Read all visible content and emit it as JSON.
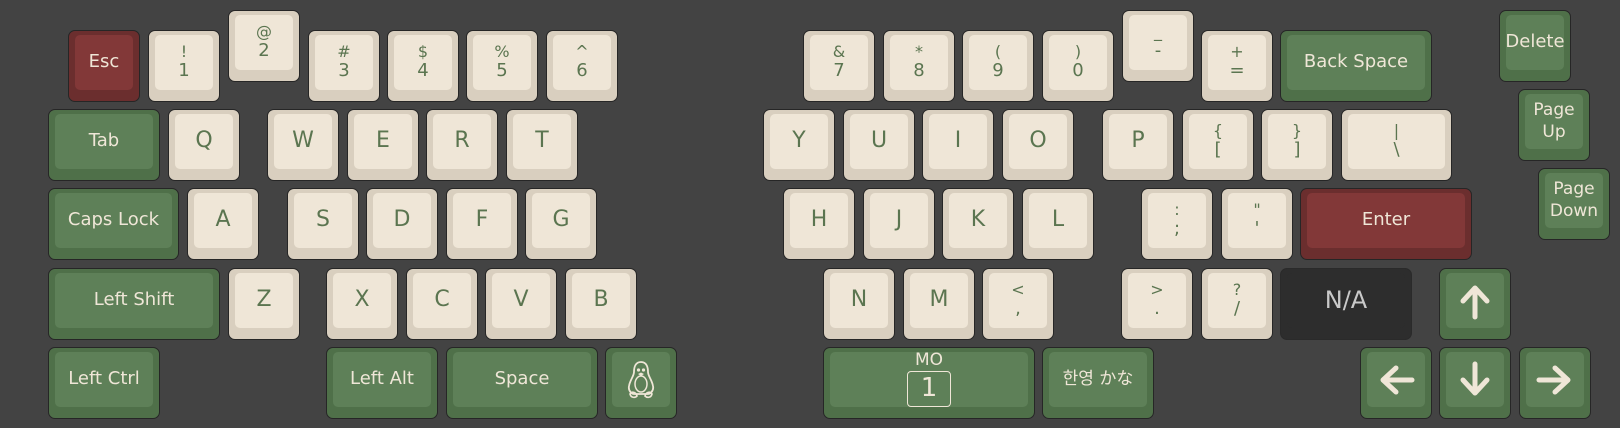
{
  "colors": {
    "background": "#434343",
    "alpha_cap": "#efe6d7",
    "alpha_text": "#5b7550",
    "mod_cap": "#5e8058",
    "accent_cap": "#823838",
    "na_cap": "#2d2d2d"
  },
  "keys": [
    {
      "id": "esc",
      "label": "Esc",
      "style": "acc",
      "text": "mod"
    },
    {
      "id": "1",
      "shift": "!",
      "base": "1",
      "style": "alpha"
    },
    {
      "id": "2",
      "shift": "@",
      "base": "2",
      "style": "alpha"
    },
    {
      "id": "3",
      "shift": "#",
      "base": "3",
      "style": "alpha"
    },
    {
      "id": "4",
      "shift": "$",
      "base": "4",
      "style": "alpha"
    },
    {
      "id": "5",
      "shift": "%",
      "base": "5",
      "style": "alpha"
    },
    {
      "id": "6",
      "shift": "^",
      "base": "6",
      "style": "alpha"
    },
    {
      "id": "7",
      "shift": "&",
      "base": "7",
      "style": "alpha"
    },
    {
      "id": "8",
      "shift": "*",
      "base": "8",
      "style": "alpha"
    },
    {
      "id": "9",
      "shift": "(",
      "base": "9",
      "style": "alpha"
    },
    {
      "id": "0",
      "shift": ")",
      "base": "0",
      "style": "alpha"
    },
    {
      "id": "minus",
      "shift": "_",
      "base": "-",
      "style": "alpha"
    },
    {
      "id": "equal",
      "shift": "+",
      "base": "=",
      "style": "alpha"
    },
    {
      "id": "backspace",
      "label": "Back Space",
      "style": "mod",
      "text": "mod"
    },
    {
      "id": "delete",
      "label": "Delete",
      "style": "mod",
      "text": "mod"
    },
    {
      "id": "tab",
      "label": "Tab",
      "style": "mod",
      "text": "mod"
    },
    {
      "id": "q",
      "label": "Q",
      "style": "alpha",
      "text": "main"
    },
    {
      "id": "w",
      "label": "W",
      "style": "alpha",
      "text": "main"
    },
    {
      "id": "e",
      "label": "E",
      "style": "alpha",
      "text": "main"
    },
    {
      "id": "r",
      "label": "R",
      "style": "alpha",
      "text": "main"
    },
    {
      "id": "t",
      "label": "T",
      "style": "alpha",
      "text": "main"
    },
    {
      "id": "y",
      "label": "Y",
      "style": "alpha",
      "text": "main"
    },
    {
      "id": "u",
      "label": "U",
      "style": "alpha",
      "text": "main"
    },
    {
      "id": "i",
      "label": "I",
      "style": "alpha",
      "text": "main"
    },
    {
      "id": "o",
      "label": "O",
      "style": "alpha",
      "text": "main"
    },
    {
      "id": "p",
      "label": "P",
      "style": "alpha",
      "text": "main"
    },
    {
      "id": "lbracket",
      "shift": "{",
      "base": "[",
      "style": "alpha"
    },
    {
      "id": "rbracket",
      "shift": "}",
      "base": "]",
      "style": "alpha"
    },
    {
      "id": "backslash",
      "shift": "|",
      "base": "\\",
      "style": "alpha"
    },
    {
      "id": "pageup",
      "label": "Page Up",
      "style": "mod",
      "text": "two"
    },
    {
      "id": "capslock",
      "label": "Caps Lock",
      "style": "mod",
      "text": "mod"
    },
    {
      "id": "a",
      "label": "A",
      "style": "alpha",
      "text": "main"
    },
    {
      "id": "s",
      "label": "S",
      "style": "alpha",
      "text": "main"
    },
    {
      "id": "d",
      "label": "D",
      "style": "alpha",
      "text": "main"
    },
    {
      "id": "f",
      "label": "F",
      "style": "alpha",
      "text": "main"
    },
    {
      "id": "g",
      "label": "G",
      "style": "alpha",
      "text": "main"
    },
    {
      "id": "h",
      "label": "H",
      "style": "alpha",
      "text": "main"
    },
    {
      "id": "j",
      "label": "J",
      "style": "alpha",
      "text": "main"
    },
    {
      "id": "k",
      "label": "K",
      "style": "alpha",
      "text": "main"
    },
    {
      "id": "l",
      "label": "L",
      "style": "alpha",
      "text": "main"
    },
    {
      "id": "semicolon",
      "shift": ":",
      "base": ";",
      "style": "alpha"
    },
    {
      "id": "quote",
      "shift": "\"",
      "base": "'",
      "style": "alpha"
    },
    {
      "id": "enter",
      "label": "Enter",
      "style": "acc",
      "text": "mod"
    },
    {
      "id": "pagedown",
      "label": "Page Down",
      "style": "mod",
      "text": "two"
    },
    {
      "id": "lshift",
      "label": "Left Shift",
      "style": "mod",
      "text": "mod"
    },
    {
      "id": "z",
      "label": "Z",
      "style": "alpha",
      "text": "main"
    },
    {
      "id": "x",
      "label": "X",
      "style": "alpha",
      "text": "main"
    },
    {
      "id": "c",
      "label": "C",
      "style": "alpha",
      "text": "main"
    },
    {
      "id": "v",
      "label": "V",
      "style": "alpha",
      "text": "main"
    },
    {
      "id": "b",
      "label": "B",
      "style": "alpha",
      "text": "main"
    },
    {
      "id": "n",
      "label": "N",
      "style": "alpha",
      "text": "main"
    },
    {
      "id": "m",
      "label": "M",
      "style": "alpha",
      "text": "main"
    },
    {
      "id": "comma",
      "shift": "<",
      "base": ",",
      "style": "alpha"
    },
    {
      "id": "period",
      "shift": ">",
      "base": ".",
      "style": "alpha"
    },
    {
      "id": "slash",
      "shift": "?",
      "base": "/",
      "style": "alpha"
    },
    {
      "id": "na",
      "label": "N/A",
      "style": "na",
      "text": "na"
    },
    {
      "id": "up",
      "icon": "arrow-up-icon",
      "style": "mod"
    },
    {
      "id": "lctrl",
      "label": "Left Ctrl",
      "style": "mod",
      "text": "mod"
    },
    {
      "id": "lalt",
      "label": "Left Alt",
      "style": "mod",
      "text": "mod"
    },
    {
      "id": "space",
      "label": "Space",
      "style": "mod",
      "text": "mod"
    },
    {
      "id": "gui",
      "icon": "linux-penguin-icon",
      "style": "mod"
    },
    {
      "id": "mo1",
      "layer_tag": "MO",
      "layer": "1",
      "style": "mod"
    },
    {
      "id": "langswitch",
      "label": "한영 かな",
      "style": "mod",
      "text": "two"
    },
    {
      "id": "left",
      "icon": "arrow-left-icon",
      "style": "mod"
    },
    {
      "id": "down",
      "icon": "arrow-down-icon",
      "style": "mod"
    },
    {
      "id": "right",
      "icon": "arrow-right-icon",
      "style": "mod"
    }
  ]
}
